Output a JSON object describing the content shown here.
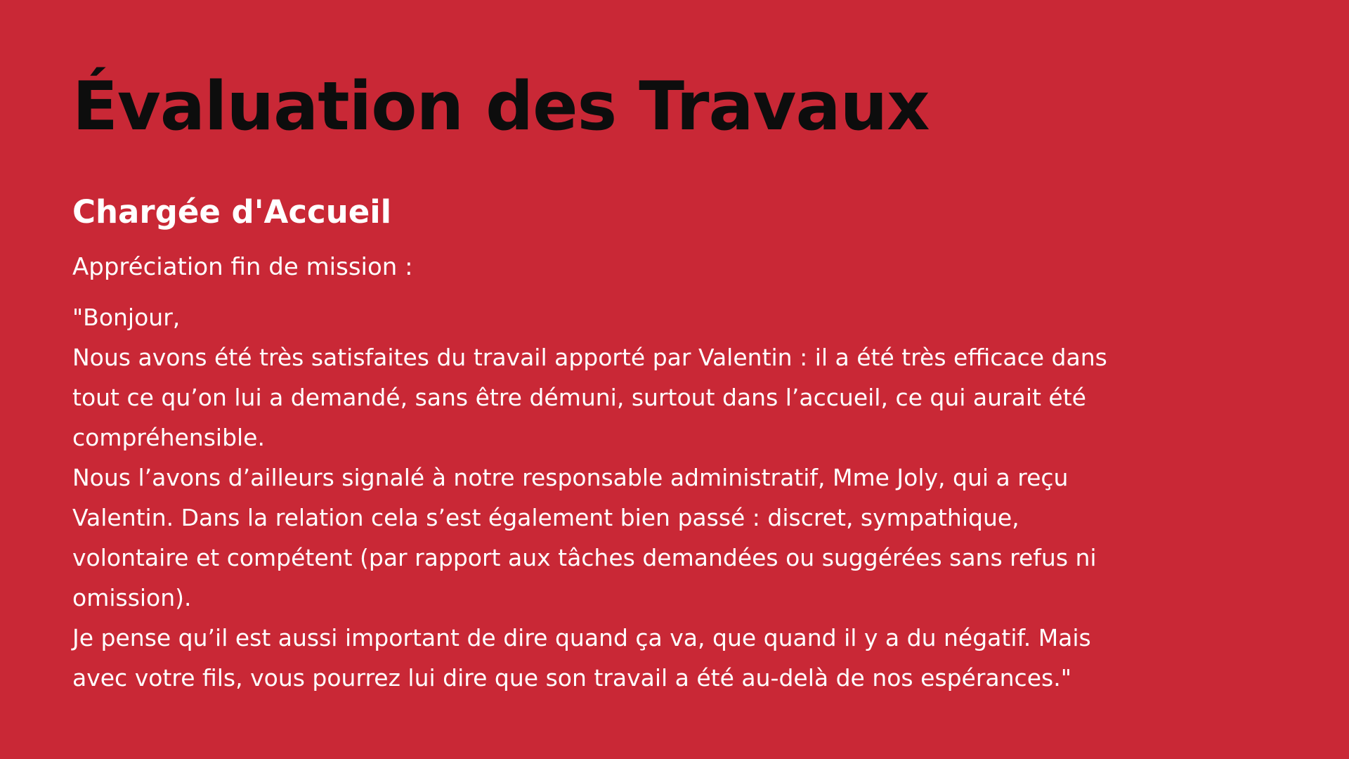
{
  "slide": {
    "title": "Évaluation des Travaux",
    "subtitle": "Chargée d'Accueil",
    "intro": "Appréciation fin de mission :",
    "body_lines": [
      "\"Bonjour,",
      "Nous avons été très satisfaites du travail apporté par Valentin : il a été très efficace dans",
      "tout ce qu’on lui a demandé, sans être démuni, surtout dans l’accueil, ce qui aurait été",
      "compréhensible.",
      "Nous l’avons d’ailleurs signalé à notre responsable administratif, Mme Joly, qui a reçu",
      "Valentin. Dans la relation cela s’est également bien passé : discret, sympathique,",
      "volontaire et compétent (par rapport aux tâches demandées ou suggérées sans refus ni",
      "omission).",
      "Je pense qu’il est aussi important de dire quand ça va, que quand il y a du négatif. Mais",
      "avec votre fils, vous pourrez lui dire que son travail a été au-delà de nos espérances.\""
    ]
  },
  "colors": {
    "background": "#c92836",
    "title": "#0d0d0d",
    "text": "#ffffff"
  }
}
